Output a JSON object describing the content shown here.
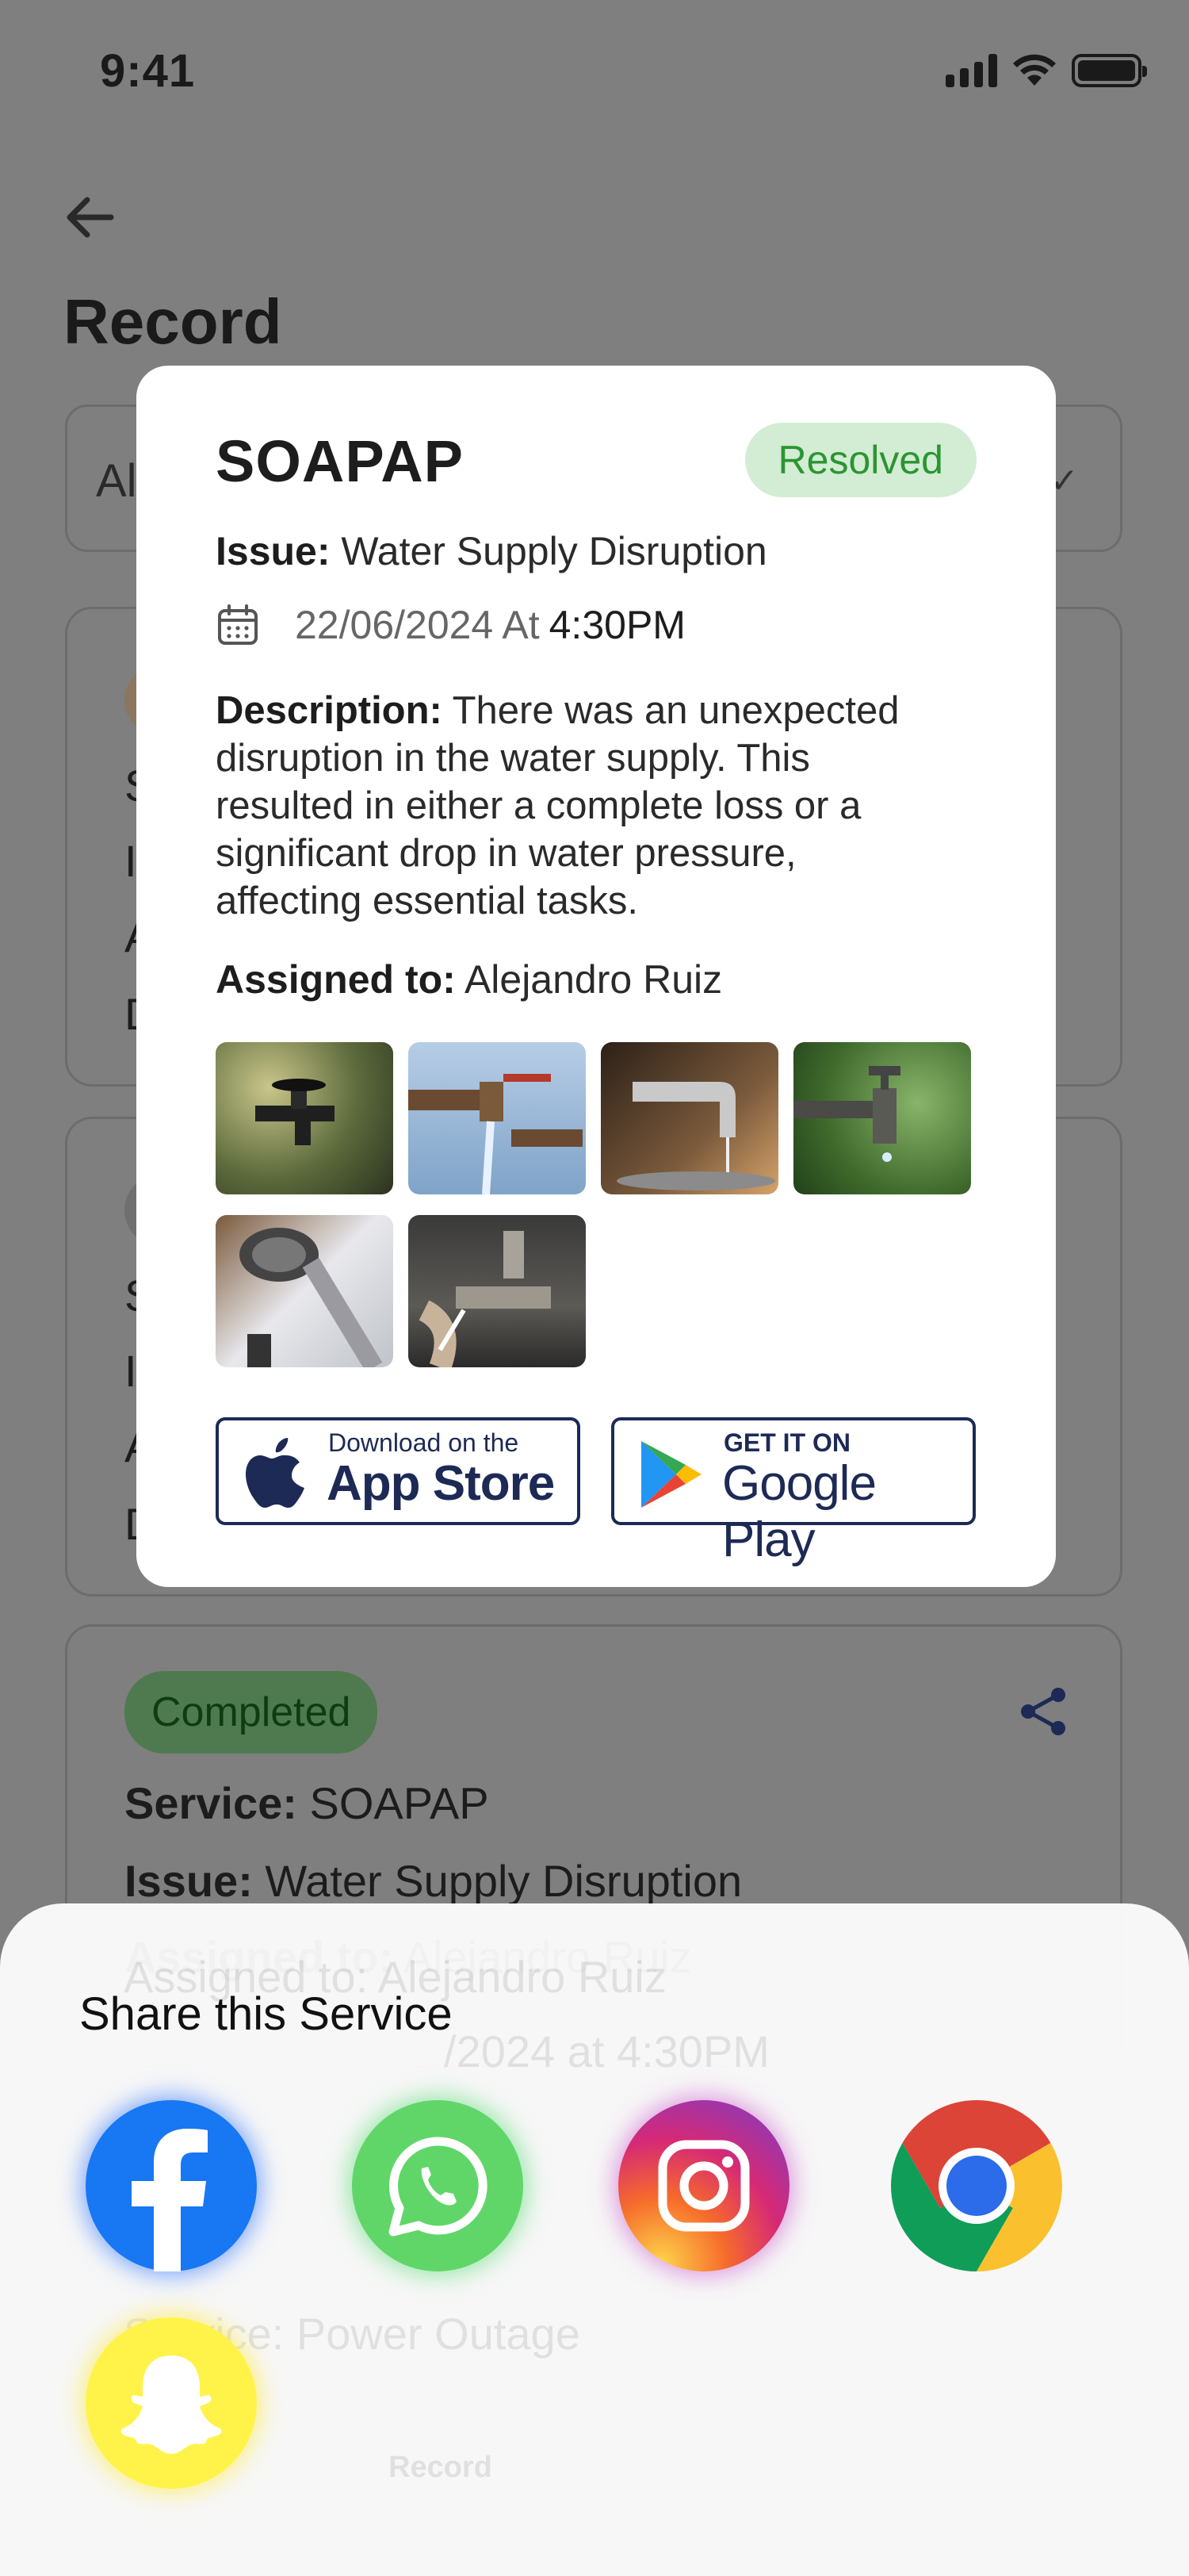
{
  "status_bar": {
    "time": "9:41"
  },
  "header": {
    "title": "Record"
  },
  "filter": {
    "value": "Al"
  },
  "background_cards": [
    {
      "rows": [
        "S",
        "I",
        "A",
        "D"
      ]
    },
    {
      "rows": [
        "S",
        "I",
        "A",
        "D"
      ]
    }
  ],
  "completed_card": {
    "status": "Completed",
    "service_label": "Service:",
    "service_value": "SOAPAP",
    "issue_label": "Issue:",
    "issue_value": "Water Supply Disruption",
    "assigned_label": "Assigned to:",
    "assigned_value": "Alejandro Ruiz",
    "date_fragment": "/2024 at 4:30PM",
    "next_service_fragment": "Service: Power Outage"
  },
  "bottom_nav": {
    "active_label": "Record"
  },
  "modal": {
    "title": "SOAPAP",
    "status": "Resolved",
    "issue_label": "Issue:",
    "issue_value": "Water Supply Disruption",
    "date": "22/06/2024 At",
    "time": "4:30PM",
    "description_label": "Description:",
    "description_value": "There was an unexpected disruption in the water supply. This resulted in either a complete loss or a significant drop in water pressure, affecting essential tasks.",
    "assigned_label": "Assigned to:",
    "assigned_value": "Alejandro Ruiz",
    "photos": [
      "faucet-1",
      "faucet-2",
      "faucet-3",
      "faucet-4",
      "shower-head",
      "faucet-6"
    ],
    "app_store": {
      "small": "Download on the",
      "big": "App Store"
    },
    "google_play": {
      "small": "GET IT ON",
      "big": "Google Play"
    }
  },
  "share_sheet": {
    "title": "Share this Service",
    "apps": [
      "facebook-icon",
      "whatsapp-icon",
      "instagram-icon",
      "chrome-icon",
      "snapchat-icon"
    ]
  },
  "colors": {
    "resolved_bg": "#d3ecd4",
    "resolved_text": "#2b9531",
    "store_border": "#1d2a55",
    "overlay": "#7f7f7f"
  }
}
